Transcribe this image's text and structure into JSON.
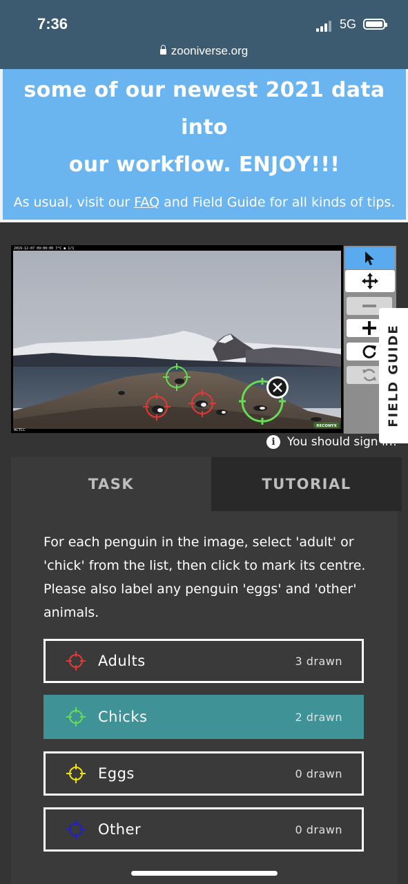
{
  "status": {
    "time": "7:36",
    "network": "5G"
  },
  "browser": {
    "url": "zooniverse.org"
  },
  "announcement": {
    "line1": "some of our newest 2021 data into",
    "line2": "our workflow. ENJOY!!!",
    "body_pre": "As usual, visit our ",
    "faq_link": "FAQ",
    "body_post": " and Field Guide for all kinds of tips."
  },
  "subject": {
    "camera_strip": "2019-12-07 09:00:00     7°C  ●     1/1",
    "corner_label": "ACTCC",
    "brand": "RECONYX"
  },
  "field_guide": "FIELD GUIDE",
  "signin_notice": "You should sign in!",
  "tabs": [
    {
      "label": "TASK"
    },
    {
      "label": "TUTORIAL"
    }
  ],
  "task": {
    "instructions": "For each penguin in the image, select 'adult' or 'chick' from the list, then click to mark its centre. Please also label any penguin 'eggs' and 'other' animals.",
    "answers": [
      {
        "label": "Adults",
        "count": "3 drawn",
        "color": "#e53935",
        "icon": "crosshair-icon"
      },
      {
        "label": "Chicks",
        "count": "2 drawn",
        "color": "#66dd55",
        "icon": "crosshair-icon"
      },
      {
        "label": "Eggs",
        "count": "0 drawn",
        "color": "#f2e600",
        "icon": "crosshair-icon"
      },
      {
        "label": "Other",
        "count": "0 drawn",
        "color": "#2020cc",
        "icon": "crosshair-icon"
      }
    ]
  },
  "colors": {
    "header_bg": "#3c5a70",
    "announce_bg": "#6ab4f0",
    "selected_answer": "#3f9397"
  }
}
